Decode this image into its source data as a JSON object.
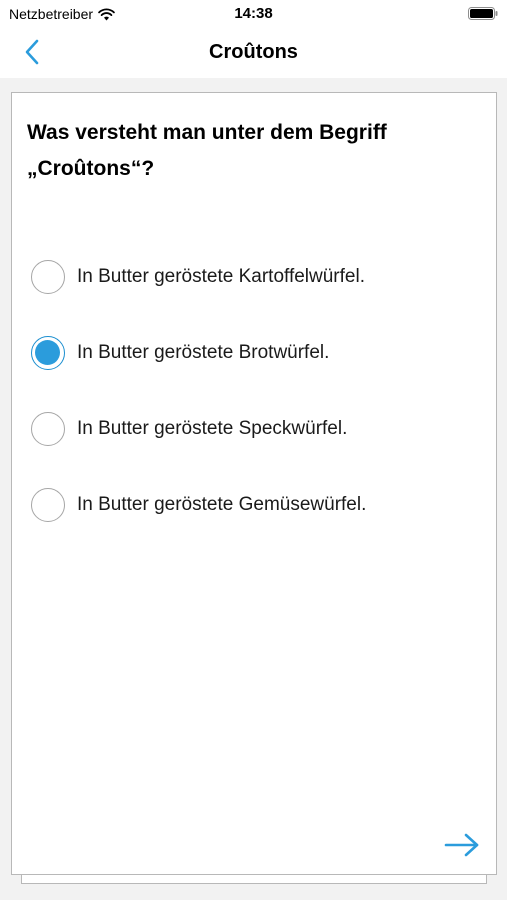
{
  "status_bar": {
    "carrier": "Netzbetreiber",
    "time": "14:38",
    "wifi_icon": "wifi-icon",
    "battery_icon": "battery-icon"
  },
  "nav": {
    "title": "Croûtons",
    "back_icon": "chevron-left-icon"
  },
  "quiz": {
    "question": "Was versteht man unter dem Begriff „Croûtons“?",
    "options": [
      {
        "label": "In Butter geröstete Kartoffelwürfel.",
        "selected": false
      },
      {
        "label": "In Butter geröstete Brotwürfel.",
        "selected": true
      },
      {
        "label": "In Butter geröstete Speckwürfel.",
        "selected": false
      },
      {
        "label": "In Butter geröstete Gemüsewürfel.",
        "selected": false
      }
    ],
    "next_icon": "arrow-right-icon"
  },
  "colors": {
    "accent": "#2b9cdc",
    "radio_border": "#a6a6a6",
    "card_border": "#b8b8b8",
    "background": "#f2f2f2"
  }
}
